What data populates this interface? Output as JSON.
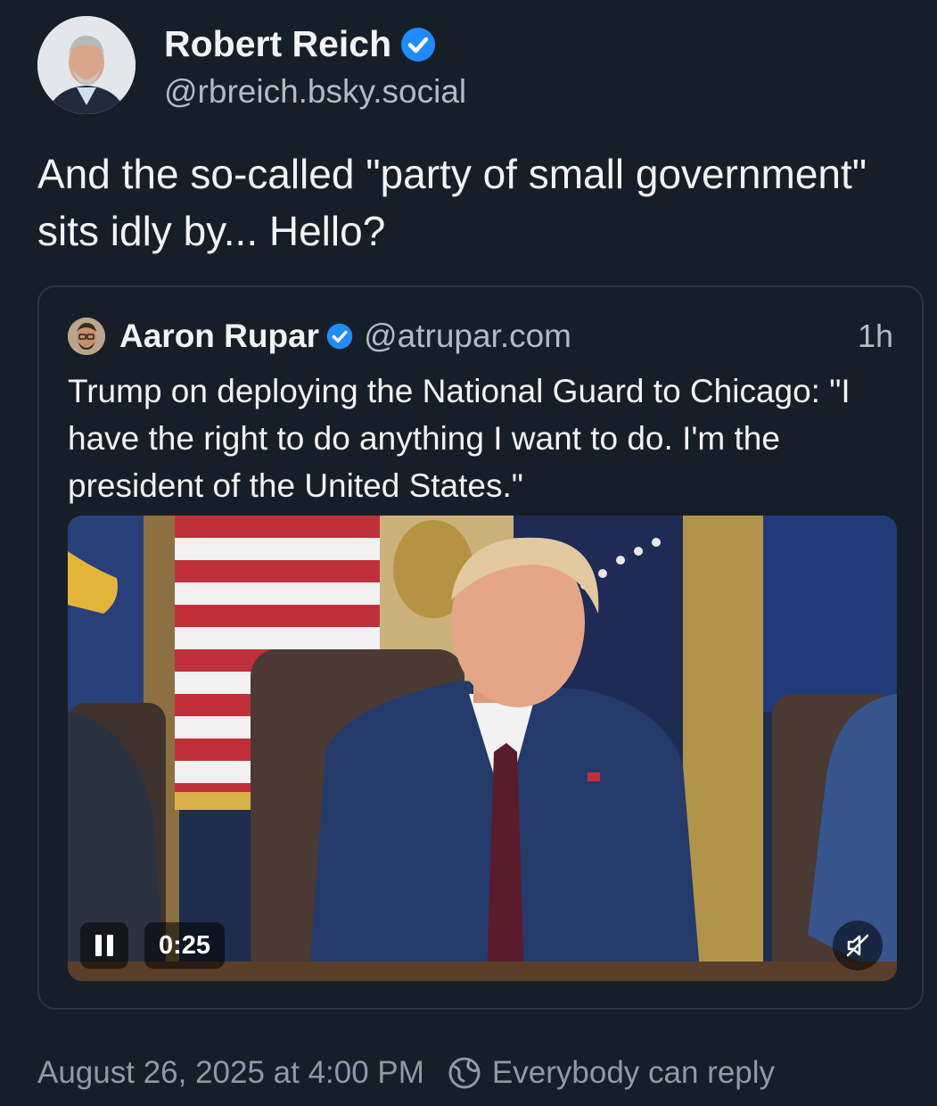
{
  "post": {
    "author_name": "Robert Reich",
    "author_handle": "@rbreich.bsky.social",
    "text": "And the so-called \"party of small government\" sits idly by... Hello?",
    "timestamp": "August 26, 2025 at 4:00 PM",
    "reply_setting": "Everybody can reply"
  },
  "quote": {
    "author_name": "Aaron Rupar",
    "author_handle": "@atrupar.com",
    "time_ago": "1h",
    "text": "Trump on deploying the National Guard to Chicago: \"I have the right to do anything I want to do. I'm the president of the United States.\""
  },
  "video": {
    "duration": "0:25",
    "state": "playing",
    "muted": true
  },
  "icons": {
    "verified": "verified-badge-icon",
    "pause": "pause-icon",
    "mute": "muted-speaker-icon",
    "reply": "globe-icon"
  },
  "colors": {
    "background": "#161e27",
    "verified": "#208bfe",
    "secondary_text": "#aebbc9"
  }
}
